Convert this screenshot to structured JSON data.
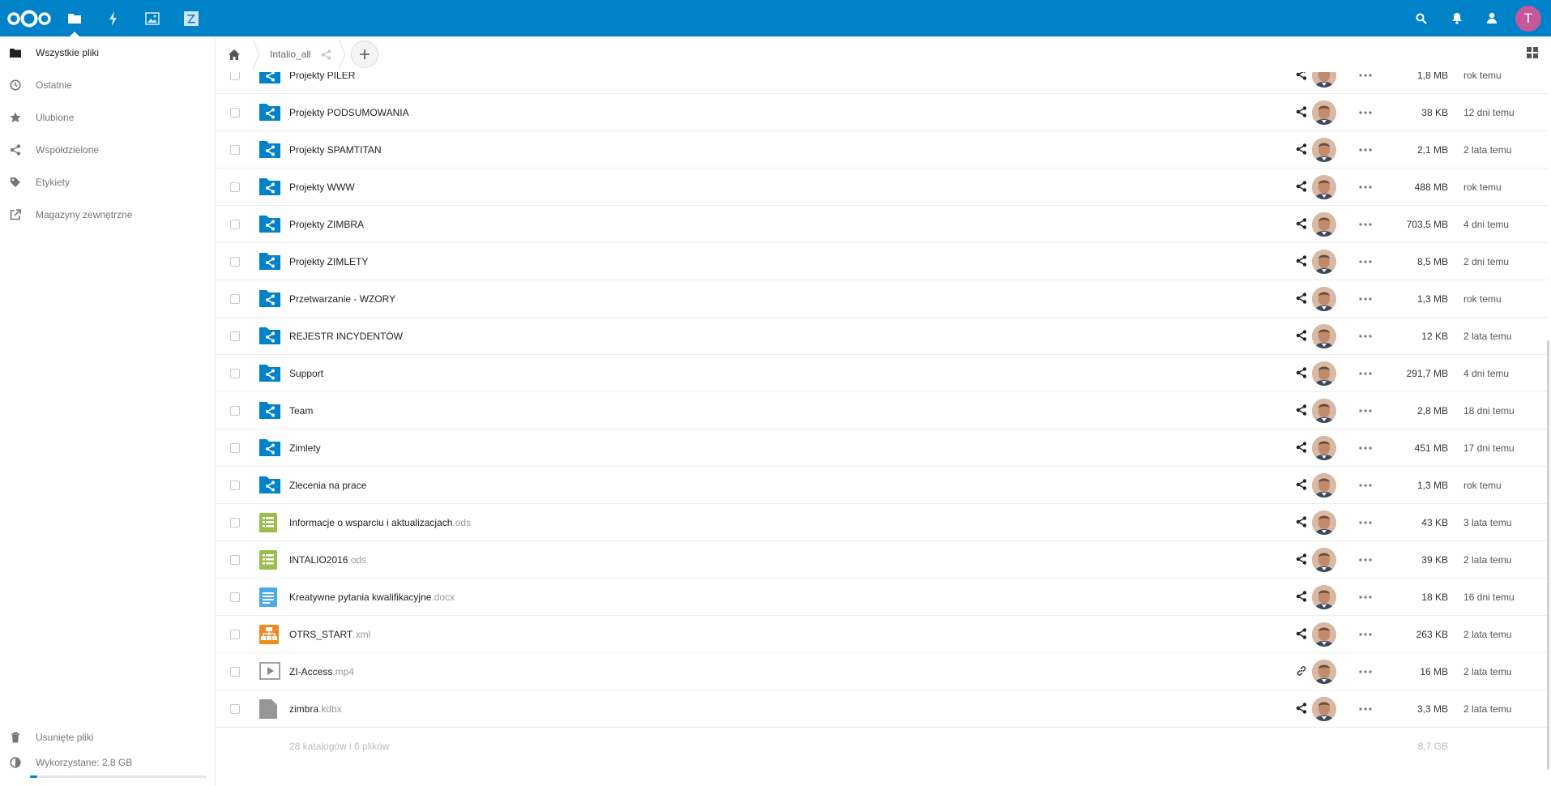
{
  "header": {
    "apps": [
      "files-icon",
      "activity-icon",
      "gallery-icon",
      "zimbra-icon"
    ],
    "avatar_letter": "T",
    "accent": "#0082c9"
  },
  "sidebar": {
    "items": [
      {
        "label": "Wszystkie pliki",
        "icon": "folder-icon"
      },
      {
        "label": "Ostatnie",
        "icon": "clock-icon"
      },
      {
        "label": "Ulubione",
        "icon": "star-icon"
      },
      {
        "label": "Współdzielone",
        "icon": "share-icon"
      },
      {
        "label": "Etykiety",
        "icon": "tag-icon"
      },
      {
        "label": "Magazyny zewnętrzne",
        "icon": "external-link-icon"
      }
    ],
    "trash_label": "Usunięte pliki",
    "quota_label": "Wykorzystane: 2.8 GB",
    "quota_fraction": 0.04
  },
  "breadcrumb": {
    "current": "Intalio_all"
  },
  "files": [
    {
      "name": "Projekty PILER",
      "ext": "",
      "type": "shared-folder",
      "size": "1,8 MB",
      "date": "rok temu",
      "share": "share"
    },
    {
      "name": "Projekty PODSUMOWANIA",
      "ext": "",
      "type": "shared-folder",
      "size": "38 KB",
      "date": "12 dni temu",
      "share": "share"
    },
    {
      "name": "Projekty SPAMTITAN",
      "ext": "",
      "type": "shared-folder",
      "size": "2,1 MB",
      "date": "2 lata temu",
      "share": "share"
    },
    {
      "name": "Projekty WWW",
      "ext": "",
      "type": "shared-folder",
      "size": "488 MB",
      "date": "rok temu",
      "share": "share"
    },
    {
      "name": "Projekty ZIMBRA",
      "ext": "",
      "type": "shared-folder",
      "size": "703,5 MB",
      "date": "4 dni temu",
      "share": "share"
    },
    {
      "name": "Projekty ZIMLETY",
      "ext": "",
      "type": "shared-folder",
      "size": "8,5 MB",
      "date": "2 dni temu",
      "share": "share"
    },
    {
      "name": "Przetwarzanie - WZORY",
      "ext": "",
      "type": "shared-folder",
      "size": "1,3 MB",
      "date": "rok temu",
      "share": "share"
    },
    {
      "name": "REJESTR INCYDENTÓW",
      "ext": "",
      "type": "shared-folder",
      "size": "12 KB",
      "date": "2 lata temu",
      "share": "share"
    },
    {
      "name": "Support",
      "ext": "",
      "type": "shared-folder",
      "size": "291,7 MB",
      "date": "4 dni temu",
      "share": "share"
    },
    {
      "name": "Team",
      "ext": "",
      "type": "shared-folder",
      "size": "2,8 MB",
      "date": "18 dni temu",
      "share": "share"
    },
    {
      "name": "Zimlety",
      "ext": "",
      "type": "shared-folder",
      "size": "451 MB",
      "date": "17 dni temu",
      "share": "share"
    },
    {
      "name": "Zlecenia na prace",
      "ext": "",
      "type": "shared-folder",
      "size": "1,3 MB",
      "date": "rok temu",
      "share": "share"
    },
    {
      "name": "Informacje o wsparciu i aktualizacjach",
      "ext": ".ods",
      "type": "spreadsheet",
      "size": "43 KB",
      "date": "3 lata temu",
      "share": "share"
    },
    {
      "name": "INTALIO2016",
      "ext": ".ods",
      "type": "spreadsheet",
      "size": "39 KB",
      "date": "2 lata temu",
      "share": "share"
    },
    {
      "name": "Kreatywne pytania kwalifikacyjne",
      "ext": ".docx",
      "type": "document",
      "size": "18 KB",
      "date": "16 dni temu",
      "share": "share"
    },
    {
      "name": "OTRS_START",
      "ext": ".xml",
      "type": "xml",
      "size": "263 KB",
      "date": "2 lata temu",
      "share": "share"
    },
    {
      "name": "ZI-Access",
      "ext": ".mp4",
      "type": "video",
      "size": "16 MB",
      "date": "2 lata temu",
      "share": "link"
    },
    {
      "name": "zimbra",
      "ext": ".kdbx",
      "type": "file",
      "size": "3,3 MB",
      "date": "2 lata temu",
      "share": "share"
    }
  ],
  "summary": {
    "text": "28 katalogów i 6 plików",
    "total": "8,7 GB"
  }
}
